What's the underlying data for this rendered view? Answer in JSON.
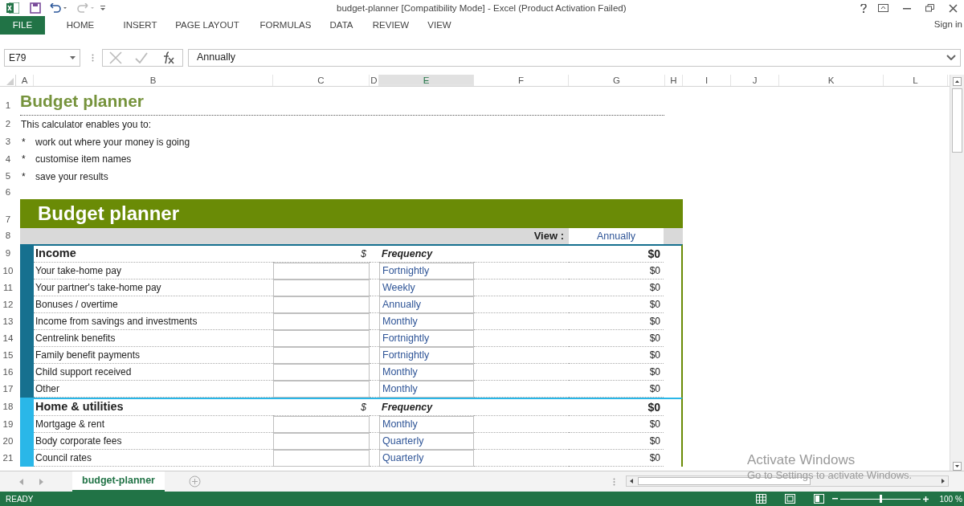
{
  "window": {
    "title": "budget-planner  [Compatibility Mode] - Excel (Product Activation Failed)",
    "sign_in": "Sign in"
  },
  "ribbon": {
    "file_tab": "FILE",
    "tabs": [
      {
        "label": "HOME",
        "selected": false
      },
      {
        "label": "INSERT",
        "selected": false
      },
      {
        "label": "PAGE LAYOUT",
        "selected": false
      },
      {
        "label": "FORMULAS",
        "selected": false
      },
      {
        "label": "DATA",
        "selected": false
      },
      {
        "label": "REVIEW",
        "selected": false
      },
      {
        "label": "VIEW",
        "selected": false
      }
    ]
  },
  "formula_bar": {
    "name_box": "E79",
    "value": "Annually"
  },
  "columns": [
    {
      "label": "A",
      "selected": false
    },
    {
      "label": "B",
      "selected": false
    },
    {
      "label": "C",
      "selected": false
    },
    {
      "label": "D",
      "selected": false
    },
    {
      "label": "E",
      "selected": true
    },
    {
      "label": "F",
      "selected": false
    },
    {
      "label": "G",
      "selected": false
    },
    {
      "label": "H",
      "selected": false
    },
    {
      "label": "I",
      "selected": false
    },
    {
      "label": "J",
      "selected": false
    },
    {
      "label": "K",
      "selected": false
    },
    {
      "label": "L",
      "selected": false
    }
  ],
  "row_numbers": [
    "1",
    "2",
    "3",
    "4",
    "5",
    "6",
    "7",
    "8",
    "9",
    "10",
    "11",
    "12",
    "13",
    "14",
    "15",
    "16",
    "17",
    "18",
    "19",
    "20",
    "21"
  ],
  "intro": {
    "title": "Budget planner",
    "lead": "This calculator enables you to:",
    "bullets": [
      {
        "mark": "*",
        "text": "work out where your money is going"
      },
      {
        "mark": "*",
        "text": "customise item names"
      },
      {
        "mark": "*",
        "text": "save your results"
      }
    ]
  },
  "planner": {
    "title": "Budget planner",
    "view_label": "View :",
    "view_value": "Annually",
    "sections": [
      {
        "name": "Income",
        "color": "#16708f",
        "dollar": "$",
        "frequency": "Frequency",
        "total": "$0",
        "items": [
          {
            "label": "Your take-home pay",
            "frequency": "Fortnightly",
            "amount": "$0"
          },
          {
            "label": "Your partner's take-home pay",
            "frequency": "Weekly",
            "amount": "$0"
          },
          {
            "label": "Bonuses / overtime",
            "frequency": "Annually",
            "amount": "$0"
          },
          {
            "label": "Income from savings and investments",
            "frequency": "Monthly",
            "amount": "$0"
          },
          {
            "label": "Centrelink benefits",
            "frequency": "Fortnightly",
            "amount": "$0"
          },
          {
            "label": "Family benefit payments",
            "frequency": "Fortnightly",
            "amount": "$0"
          },
          {
            "label": "Child support received",
            "frequency": "Monthly",
            "amount": "$0"
          },
          {
            "label": "Other",
            "frequency": "Monthly",
            "amount": "$0"
          }
        ]
      },
      {
        "name": "Home & utilities",
        "color": "#2ab7e8",
        "dollar": "$",
        "frequency": "Frequency",
        "total": "$0",
        "items": [
          {
            "label": "Mortgage & rent",
            "frequency": "Monthly",
            "amount": "$0"
          },
          {
            "label": "Body corporate fees",
            "frequency": "Quarterly",
            "amount": "$0"
          },
          {
            "label": "Council rates",
            "frequency": "Quarterly",
            "amount": "$0"
          }
        ]
      }
    ]
  },
  "sheet_tabs": [
    {
      "label": "budget-planner",
      "selected": true
    }
  ],
  "status_bar": {
    "status": "READY",
    "zoom": "100 %",
    "zoom_level": {
      "level": 0.5
    }
  },
  "activation_notice": {
    "title": "Activate Windows",
    "message": "Go to Settings to activate Windows."
  }
}
